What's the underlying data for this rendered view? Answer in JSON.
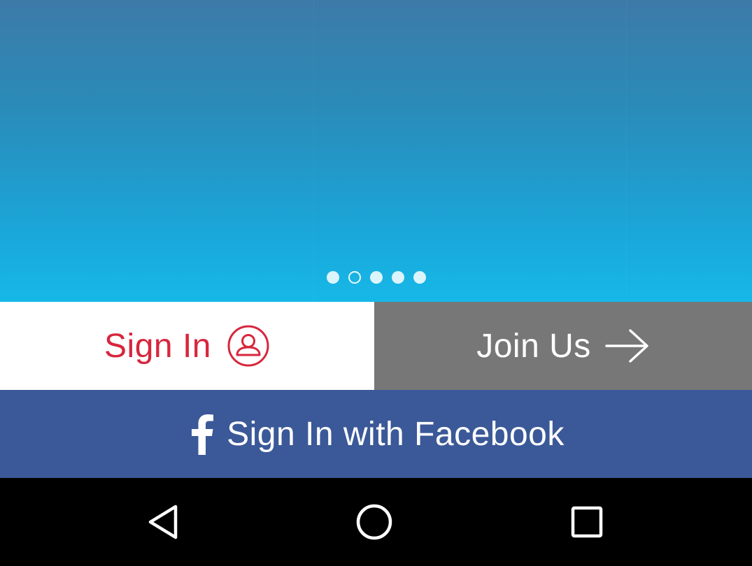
{
  "carousel": {
    "slide_count": 5,
    "active_index": 1
  },
  "auth": {
    "sign_in_label": "Sign In",
    "join_label": "Join Us",
    "facebook_label": "Sign In with Facebook"
  },
  "colors": {
    "sign_in_text": "#d7263d",
    "join_bg": "#777777",
    "facebook_bg": "#3b5998",
    "hero_top": "#3d7aa8",
    "hero_bottom": "#16b8e8"
  },
  "icons": {
    "sign_in": "user-circle-icon",
    "join": "arrow-right-icon",
    "facebook": "facebook-icon",
    "nav_back": "back-triangle-icon",
    "nav_home": "home-circle-icon",
    "nav_recents": "recents-square-icon"
  }
}
